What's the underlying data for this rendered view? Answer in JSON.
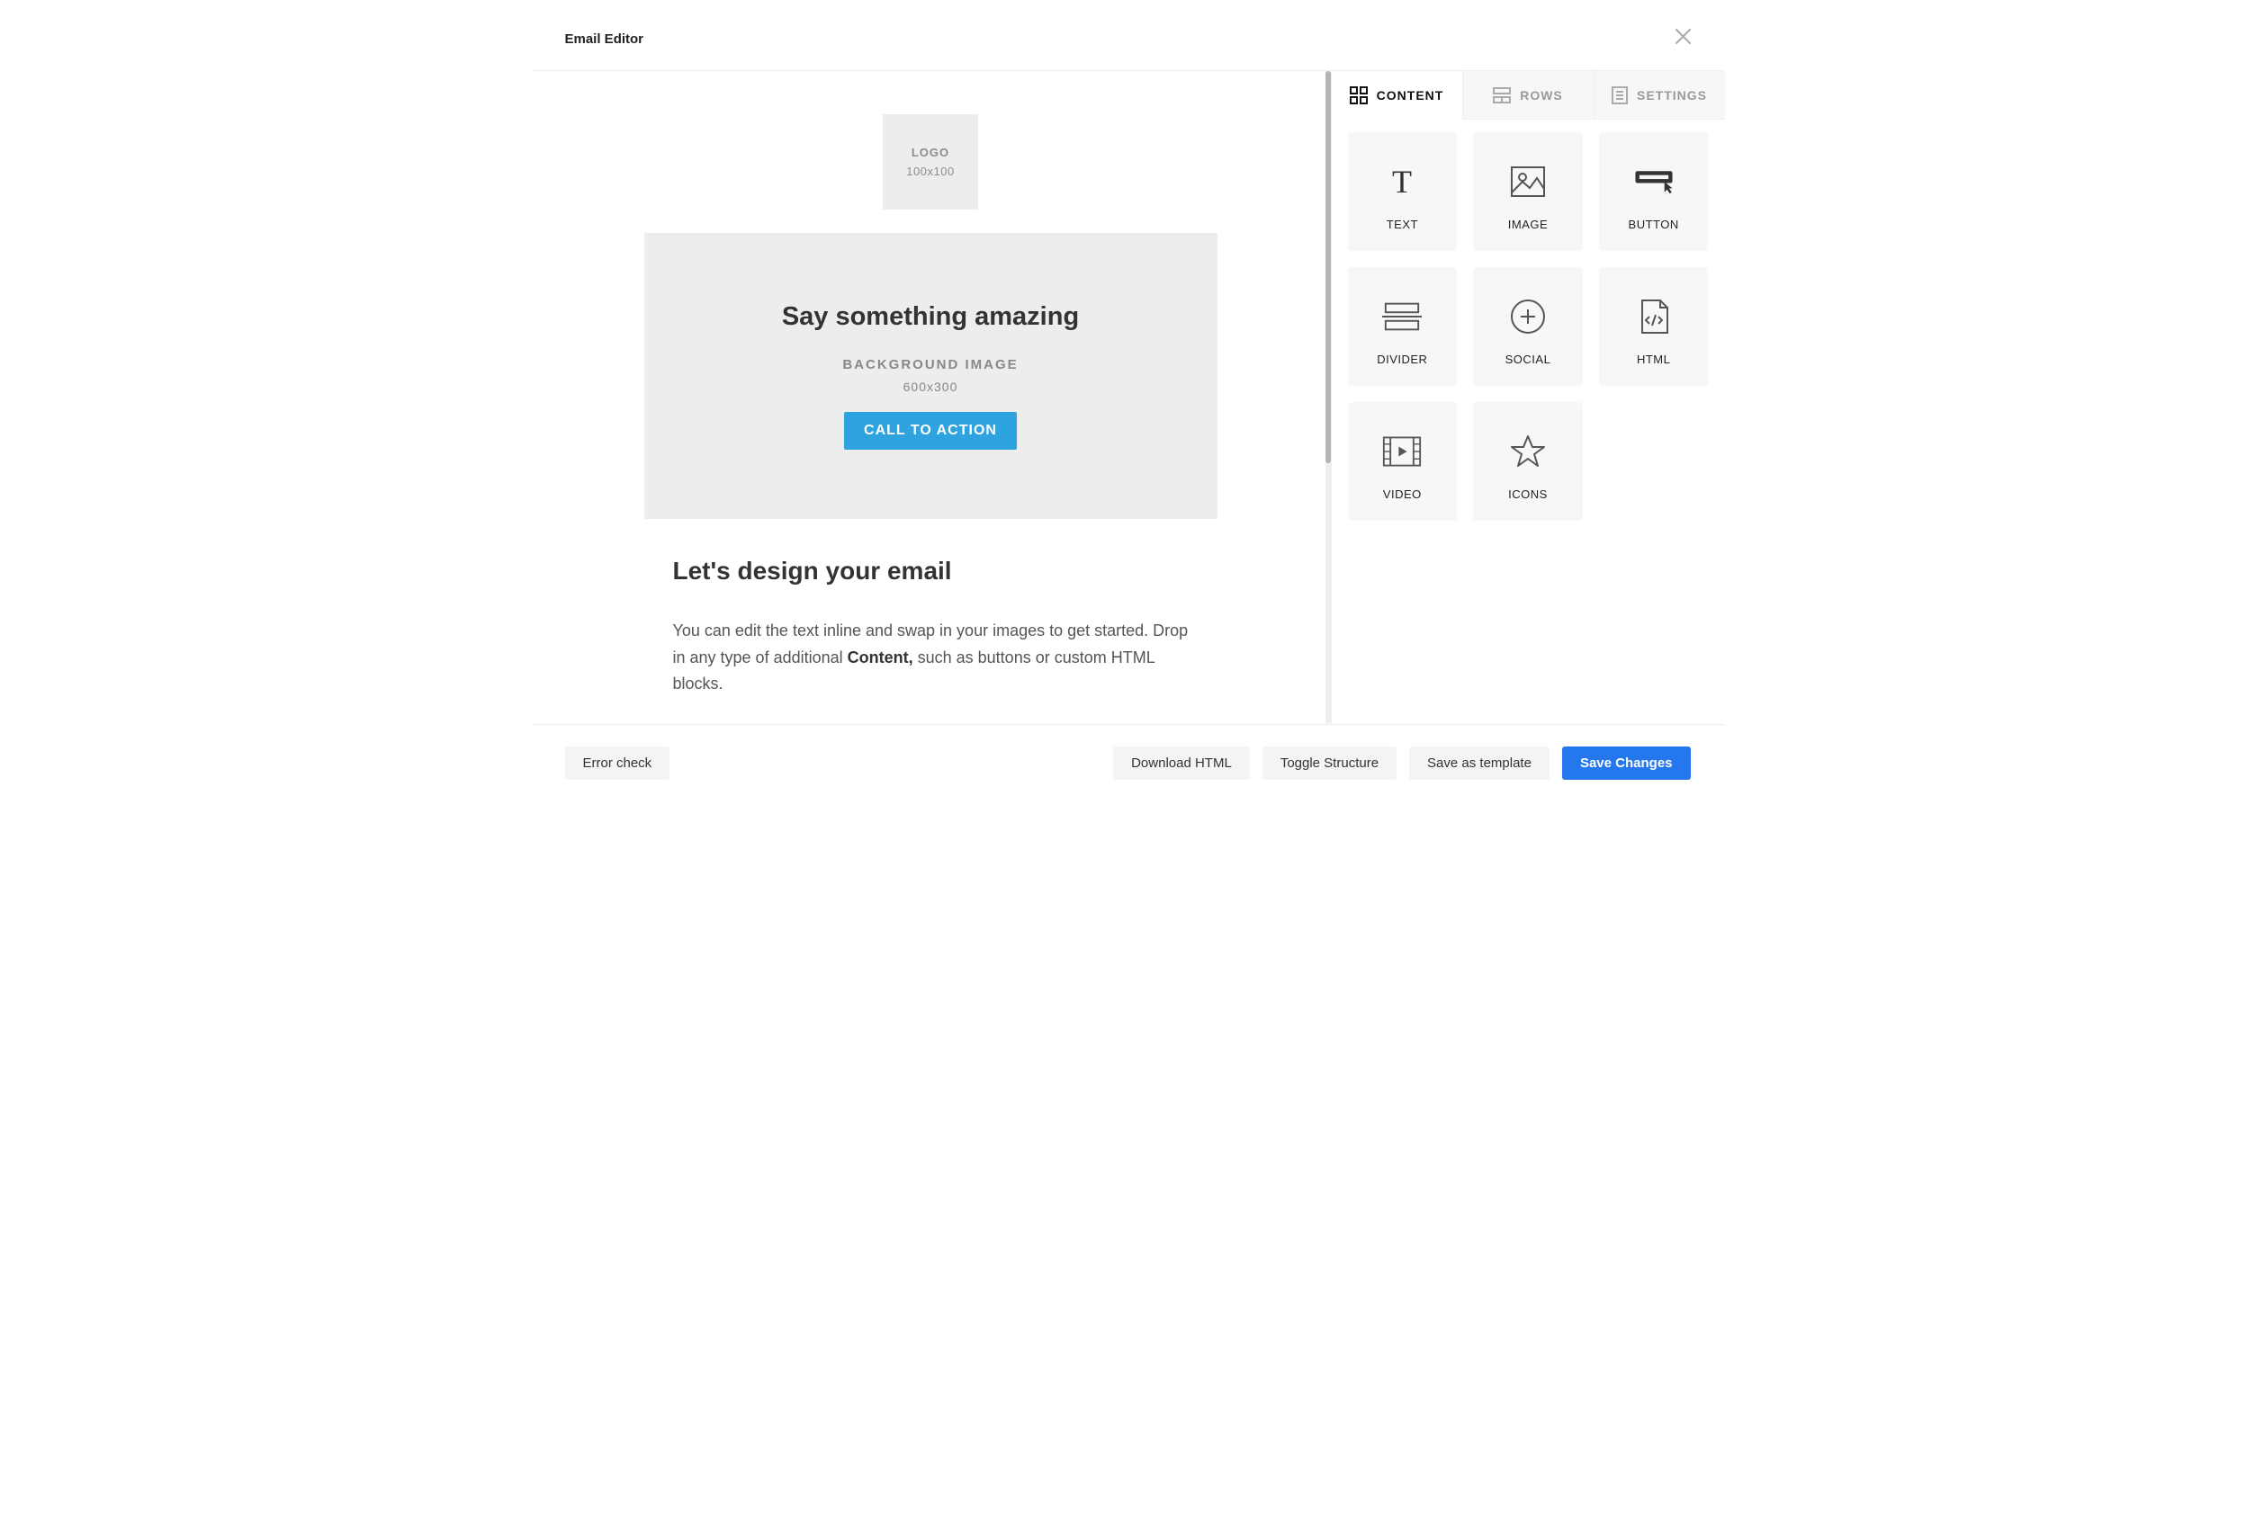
{
  "header": {
    "title": "Email Editor"
  },
  "canvas": {
    "logo": {
      "label": "LOGO",
      "dimensions": "100x100"
    },
    "hero": {
      "heading": "Say something amazing",
      "bg_label": "BACKGROUND IMAGE",
      "dimensions": "600x300",
      "cta": "CALL TO ACTION"
    },
    "body": {
      "heading": "Let's design your email",
      "paragraph_before": "You can edit the text inline and swap in your images to get started. Drop in any type of additional ",
      "paragraph_bold": "Content,",
      "paragraph_after": " such as buttons or custom HTML blocks."
    }
  },
  "sidebar": {
    "tabs": [
      {
        "label": "CONTENT",
        "active": true
      },
      {
        "label": "ROWS",
        "active": false
      },
      {
        "label": "SETTINGS",
        "active": false
      }
    ],
    "blocks": [
      {
        "label": "TEXT"
      },
      {
        "label": "IMAGE"
      },
      {
        "label": "BUTTON"
      },
      {
        "label": "DIVIDER"
      },
      {
        "label": "SOCIAL"
      },
      {
        "label": "HTML"
      },
      {
        "label": "VIDEO"
      },
      {
        "label": "ICONS"
      }
    ]
  },
  "footer": {
    "error_check": "Error check",
    "download": "Download HTML",
    "toggle": "Toggle Structure",
    "save_template": "Save as template",
    "save_changes": "Save Changes"
  }
}
